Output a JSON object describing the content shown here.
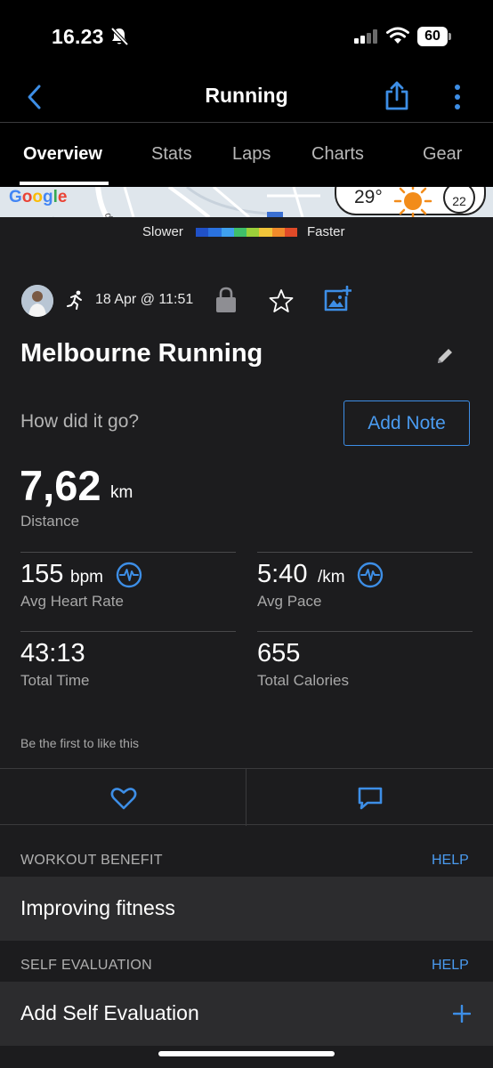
{
  "status_bar": {
    "time": "16.23",
    "battery": "60"
  },
  "nav": {
    "title": "Running"
  },
  "tabs": [
    {
      "label": "Overview",
      "active": true
    },
    {
      "label": "Stats"
    },
    {
      "label": "Laps"
    },
    {
      "label": "Charts"
    },
    {
      "label": "Gear"
    }
  ],
  "map": {
    "brand": "Google",
    "temperature": "29°",
    "wind": "22"
  },
  "legend": {
    "slower": "Slower",
    "faster": "Faster",
    "colors": [
      "#2051c8",
      "#2a72e0",
      "#3fa0ee",
      "#3fbf6a",
      "#9bd03a",
      "#f0c43a",
      "#f08a2a",
      "#e04a28"
    ]
  },
  "activity": {
    "date": "18 Apr @ 11:51",
    "name": "Melbourne Running",
    "prompt": "How did it go?",
    "add_note": "Add Note"
  },
  "stats": {
    "distance": {
      "value": "7,62",
      "unit": "km",
      "label": "Distance"
    },
    "heart_rate": {
      "value": "155",
      "unit": "bpm",
      "label": "Avg Heart Rate"
    },
    "pace": {
      "value": "5:40",
      "unit": "/km",
      "label": "Avg Pace"
    },
    "time": {
      "value": "43:13",
      "label": "Total Time"
    },
    "calories": {
      "value": "655",
      "label": "Total Calories"
    }
  },
  "social": {
    "like_text": "Be the first to like this"
  },
  "sections": {
    "workout_benefit": {
      "title": "WORKOUT BENEFIT",
      "help": "HELP",
      "value": "Improving fitness"
    },
    "self_evaluation": {
      "title": "SELF EVALUATION",
      "help": "HELP",
      "value": "Add Self Evaluation"
    }
  },
  "colors": {
    "accent": "#4a9bf0",
    "background": "#1c1c1e",
    "card": "#2c2c2e"
  }
}
